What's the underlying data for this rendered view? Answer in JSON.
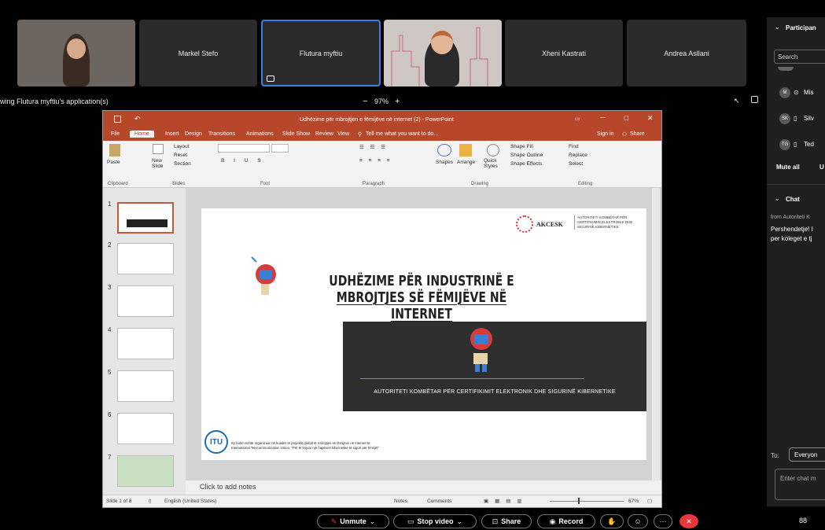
{
  "menu_bar_text": "— — — — — —  — — —  — — — —",
  "participants_tiles": [
    {
      "name": ""
    },
    {
      "name": "Markel Stefo"
    },
    {
      "name": "Flutura myftiu"
    },
    {
      "name": ""
    },
    {
      "name": "Xheni Kastrati"
    },
    {
      "name": "Andrea Asllani"
    }
  ],
  "share_bar": {
    "viewing_text": "wing Flutura myftiu's application(s)",
    "zoom_minus": "−",
    "zoom_level": "97%",
    "zoom_plus": "+"
  },
  "ppt": {
    "title": "Udhëzime për mbrojtjen e fëmijëve në internet (2) - PowerPoint",
    "signin": "Sign in",
    "share": "Share",
    "tell_me": "Tell me what you want to do...",
    "tabs": [
      "File",
      "Home",
      "Insert",
      "Design",
      "Transitions",
      "Animations",
      "Slide Show",
      "Review",
      "View"
    ],
    "ribbon": {
      "paste": "Paste",
      "new_slide": "New Slide",
      "layout": "Layout",
      "reset": "Reset",
      "section": "Section",
      "shapes": "Shapes",
      "arrange": "Arrange",
      "quick_styles": "Quick Styles",
      "shape_fill": "Shape Fill",
      "shape_outline": "Shape Outline",
      "shape_effects": "Shape Effects",
      "find": "Find",
      "replace": "Replace",
      "select": "Select",
      "groups": [
        "Clipboard",
        "Slides",
        "Font",
        "Paragraph",
        "Drawing",
        "Editing"
      ]
    },
    "thumb_numbers": [
      "1",
      "2",
      "3",
      "4",
      "5",
      "6",
      "7"
    ],
    "slide": {
      "logo_name": "AKCESK",
      "logo_text": "AUTORITETI KOMBËTAR PËR CERTIFIKIMIN ELEKTRONIK DHE SIGURINË KIBERNETIKE",
      "title_line1": "UDHËZIME PËR INDUSTRINË E",
      "title_line2": "MBROJTJES SË FËMIJËVE NË INTERNET",
      "banner_text": "AUTORITETI KOMBËTAR PËR CERTIFIKIMIT ELEKTRONIK DHE SIGURINË KIBERNETIKE",
      "itu_label": "ITU",
      "footer_line1": "Ky botim është organizuar në kuadër të projektit global të mbrojtjes së fëmijëve në internet të",
      "footer_line2": "International Telecommunication Union. \"Për të krijuar një hapësirë kibernetike të sigurt për fëmijët\""
    },
    "notes_placeholder": "Click to add notes",
    "status": {
      "slide_of": "Slide 1 of 8",
      "language": "English (United States)",
      "notes": "Notes",
      "comments": "Comments",
      "zoom": "67%"
    }
  },
  "right_panel": {
    "participants_title": "Participan",
    "search_placeholder": "Search",
    "people": [
      {
        "initials": "M",
        "name": "Mis"
      },
      {
        "initials": "SK",
        "name": "Silv"
      },
      {
        "initials": "TG",
        "name": "Ted"
      }
    ],
    "mute_all": "Mute all",
    "mute_all_suffix": "U",
    "chat_title": "Chat",
    "chat_from": "from Autoriteti K",
    "chat_msg1": "Pershendetje! I",
    "chat_msg2": "per koleget e tj",
    "to_label": "To:",
    "to_value": "Everyon",
    "chat_placeholder": "Enter chat m"
  },
  "bottom_bar": {
    "unmute": "Unmute",
    "stop_video": "Stop video",
    "share": "Share",
    "record": "Record",
    "more": "···",
    "layout_icon_text": "88"
  },
  "colors": {
    "ppt_accent": "#b7472a",
    "active_tile_border": "#3c7ee8",
    "end_button": "#e8383d",
    "unmute_icon": "#e8383d"
  }
}
